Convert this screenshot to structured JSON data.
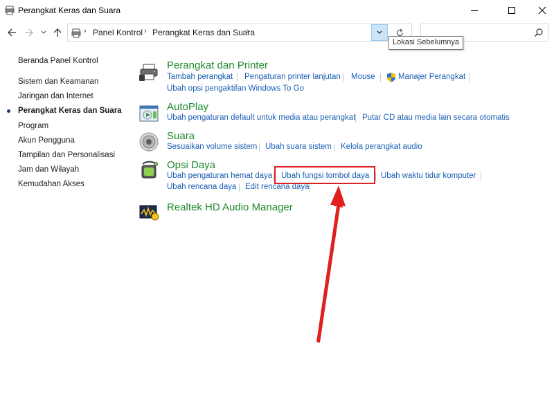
{
  "window": {
    "title": "Perangkat Keras dan Suara"
  },
  "address": {
    "crumbs": [
      "Panel Kontrol",
      "Perangkat Keras dan Suara"
    ],
    "search_placeholder": ""
  },
  "tooltip": {
    "text": "Lokasi Sebelumnya"
  },
  "sidebar": {
    "items": [
      {
        "label": "Beranda Panel Kontrol",
        "current": false
      },
      {
        "label": "Sistem dan Keamanan",
        "current": false
      },
      {
        "label": "Jaringan dan Internet",
        "current": false
      },
      {
        "label": "Perangkat Keras dan Suara",
        "current": true
      },
      {
        "label": "Program",
        "current": false
      },
      {
        "label": "Akun Pengguna",
        "current": false
      },
      {
        "label": "Tampilan dan Personalisasi",
        "current": false
      },
      {
        "label": "Jam dan Wilayah",
        "current": false
      },
      {
        "label": "Kemudahan Akses",
        "current": false
      }
    ]
  },
  "sections": {
    "devices": {
      "title": "Perangkat dan Printer",
      "links": [
        "Tambah perangkat",
        "Pengaturan printer lanjutan",
        "Mouse",
        "Manajer Perangkat",
        "Ubah opsi pengaktifan Windows To Go"
      ]
    },
    "autoplay": {
      "title": "AutoPlay",
      "links": [
        "Ubah pengaturan default untuk media atau perangkat",
        "Putar CD atau media lain secara otomatis"
      ]
    },
    "sound": {
      "title": "Suara",
      "links": [
        "Sesuaikan volume sistem",
        "Ubah suara sistem",
        "Kelola perangkat audio"
      ]
    },
    "power": {
      "title": "Opsi Daya",
      "links": [
        "Ubah pengaturan hemat daya",
        "Ubah fungsi tombol daya",
        "Ubah waktu tidur komputer",
        "Ubah rencana daya",
        "Edit rencana daya"
      ]
    },
    "realtek": {
      "title": "Realtek HD Audio Manager"
    }
  },
  "colors": {
    "link": "#1a5fb4",
    "section_title": "#1e8a2c",
    "annotation": "#e0201f"
  }
}
